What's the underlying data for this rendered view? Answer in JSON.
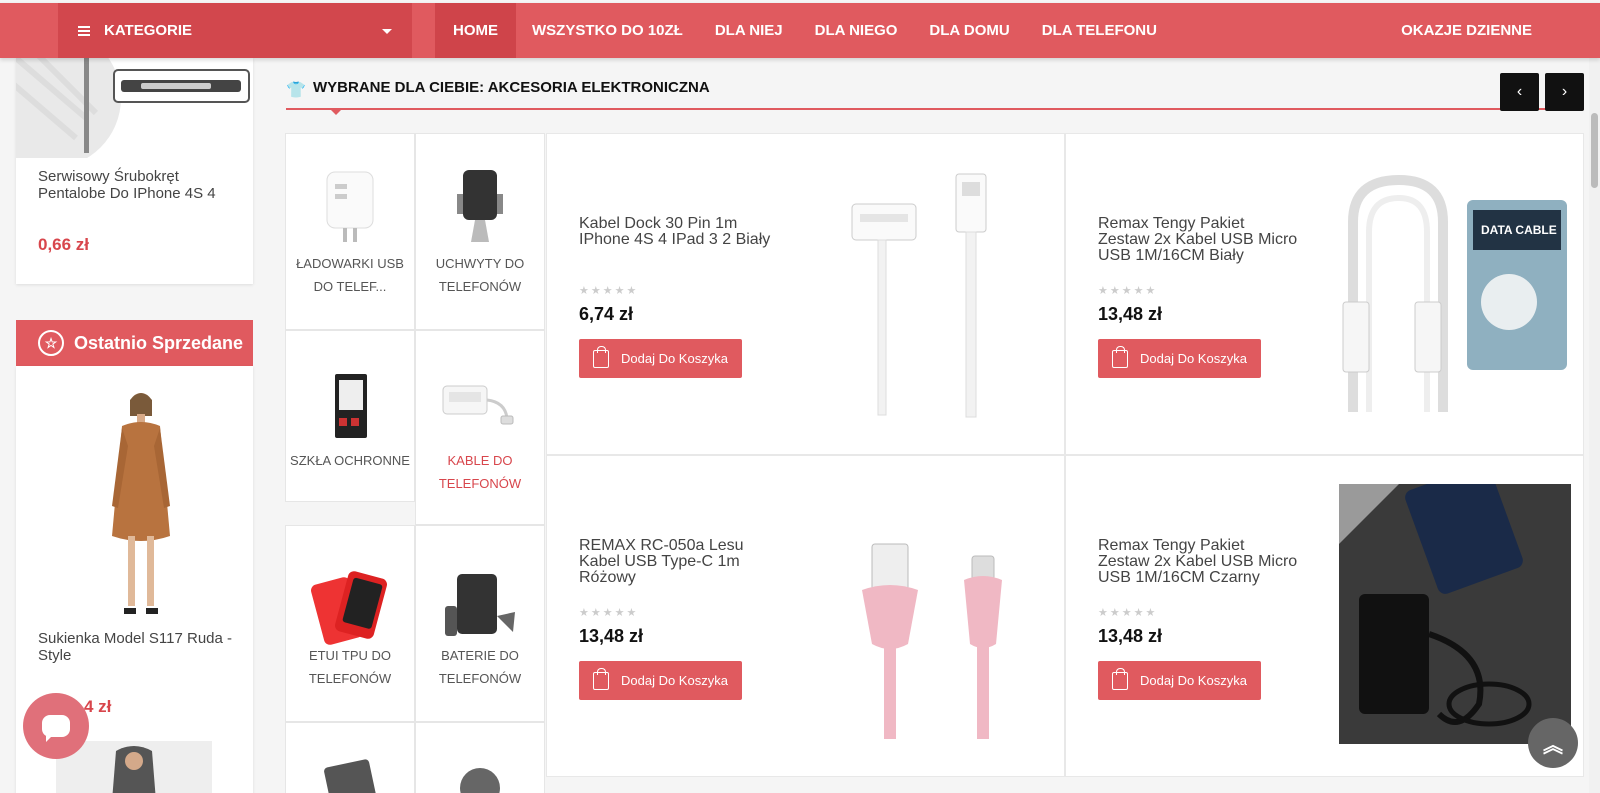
{
  "nav": {
    "category_label": "KATEGORIE",
    "items": [
      "HOME",
      "WSZYSTKO DO 10ZŁ",
      "DLA NIEJ",
      "DLA NIEGO",
      "DLA DOMU",
      "DLA TELEFONU"
    ],
    "right_label": "OKAZJE DZIENNE"
  },
  "sidebar": {
    "product1": {
      "title": "Serwisowy Śrubokręt Pentalobe Do IPhone 4S 4",
      "price": "0,66 zł"
    },
    "recently_sold": "Ostatnio Sprzedane",
    "product2": {
      "title": "Sukienka Model S117 Ruda - Style",
      "price": "4 zł"
    }
  },
  "section": {
    "title": "WYBRANE DLA CIEBIE: AKCESORIA ELEKTRONICZNA"
  },
  "categories": [
    {
      "label": "ŁADOWARKI USB DO TELEF..."
    },
    {
      "label": "UCHWYTY DO TELEFONÓW"
    },
    {
      "label": "SZKŁA OCHRONNE"
    },
    {
      "label": "KABLE DO TELEFONÓW"
    },
    {
      "label": "ETUI TPU DO TELEFONÓW"
    },
    {
      "label": "BATERIE DO TELEFONÓW"
    }
  ],
  "products": [
    {
      "title": "Kabel Dock 30 Pin 1m IPhone 4S 4 IPad 3 2 Biały",
      "price": "6,74 zł",
      "button": "Dodaj Do Koszyka",
      "stars": "★★★★★"
    },
    {
      "title": "Remax Tengy Pakiet Zestaw 2x Kabel USB Micro USB 1M/16CM Biały",
      "price": "13,48 zł",
      "button": "Dodaj Do Koszyka",
      "stars": "★★★★★"
    },
    {
      "title": "REMAX RC-050a Lesu Kabel USB Type-C 1m Różowy",
      "price": "13,48 zł",
      "button": "Dodaj Do Koszyka",
      "stars": "★★★★★"
    },
    {
      "title": "Remax Tengy Pakiet Zestaw 2x Kabel USB Micro USB 1M/16CM Czarny",
      "price": "13,48 zł",
      "button": "Dodaj Do Koszyka",
      "stars": "★★★★★"
    }
  ],
  "colors": {
    "accent": "#e05a5f",
    "accent_dark": "#d2474d"
  },
  "icons": {
    "menu": "hamburger-icon",
    "prev": "chevron-left-icon",
    "next": "chevron-right-icon",
    "to_top": "double-chevron-up-icon",
    "chat": "chat-bubble-icon"
  }
}
